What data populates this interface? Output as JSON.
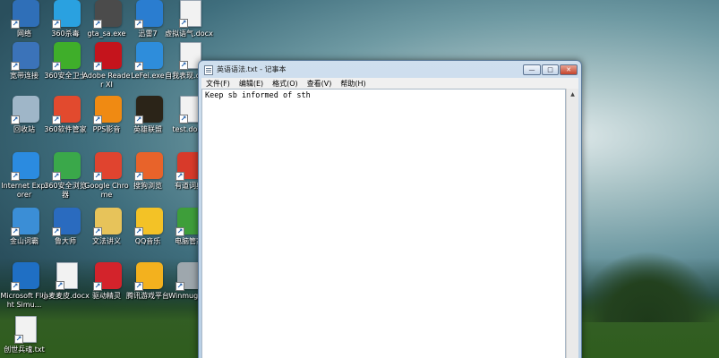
{
  "desktop_icons": [
    {
      "label": "网络",
      "icon": "network-icon",
      "color": "#2f6fb8"
    },
    {
      "label": "360杀毒",
      "icon": "360-antivirus-icon",
      "color": "#2aa1e0"
    },
    {
      "label": "gta_sa.exe",
      "icon": "gta-icon",
      "color": "#4b4b4b"
    },
    {
      "label": "迅雷7",
      "icon": "xunlei-icon",
      "color": "#2a7dd0"
    },
    {
      "label": "虚拟语气.docx",
      "icon": "docx-icon",
      "color": "#f2f2f2"
    },
    {
      "label": "宽带连接",
      "icon": "broadband-icon",
      "color": "#3b73b9"
    },
    {
      "label": "360安全卫士",
      "icon": "360-safe-icon",
      "color": "#3fae2a"
    },
    {
      "label": "Adobe Reader XI",
      "icon": "adobe-reader-icon",
      "color": "#c5141c"
    },
    {
      "label": "LeFei.exe",
      "icon": "lefei-icon",
      "color": "#2e8ddb"
    },
    {
      "label": "自我表现.docx",
      "icon": "docx-icon",
      "color": "#f2f2f2"
    },
    {
      "label": "回收站",
      "icon": "recycle-bin-icon",
      "color": "#9fb6c8"
    },
    {
      "label": "360软件管家",
      "icon": "360-software-icon",
      "color": "#e24a2e"
    },
    {
      "label": "PPS影音",
      "icon": "pps-icon",
      "color": "#f08a12"
    },
    {
      "label": "英雄联盟",
      "icon": "lol-icon",
      "color": "#2b2418"
    },
    {
      "label": "test.docx",
      "icon": "docx-icon",
      "color": "#f2f2f2"
    },
    {
      "label": "Internet Explorer",
      "icon": "ie-icon",
      "color": "#2b8be0"
    },
    {
      "label": "360安全浏览器",
      "icon": "360-browser-icon",
      "color": "#3aa84a"
    },
    {
      "label": "Google Chrome",
      "icon": "chrome-icon",
      "color": "#e0442f"
    },
    {
      "label": "搜狗浏览",
      "icon": "sogou-icon",
      "color": "#e8632a"
    },
    {
      "label": "有道词典",
      "icon": "youdao-icon",
      "color": "#d83a2a"
    },
    {
      "label": "金山词霸",
      "icon": "kingsoft-icon",
      "color": "#3b8ed6"
    },
    {
      "label": "鲁大师",
      "icon": "ludashi-icon",
      "color": "#2a6bbf"
    },
    {
      "label": "文法讲义",
      "icon": "folder-icon",
      "color": "#e7c35a"
    },
    {
      "label": "QQ音乐",
      "icon": "qq-music-icon",
      "color": "#f3c226"
    },
    {
      "label": "电脑管家",
      "icon": "pc-manager-icon",
      "color": "#3e9e3a"
    },
    {
      "label": "Microsoft Flight Simu...",
      "icon": "flight-sim-icon",
      "color": "#1f6fc4"
    },
    {
      "label": "小麦麦皮.docx",
      "icon": "docx-icon",
      "color": "#f2f2f2"
    },
    {
      "label": "驱动精灵",
      "icon": "driver-icon",
      "color": "#d3232b"
    },
    {
      "label": "腾讯游戏平台",
      "icon": "tencent-games-icon",
      "color": "#f3b11e"
    },
    {
      "label": "Winmuge...",
      "icon": "winmuge-icon",
      "color": "#9ea7ad"
    },
    {
      "label": "创世兵魂.txt",
      "icon": "txt-icon",
      "color": "#f2f2f2"
    }
  ],
  "notepad": {
    "title": "英语语法.txt - 记事本",
    "menu": [
      "文件(F)",
      "编辑(E)",
      "格式(O)",
      "查看(V)",
      "帮助(H)"
    ],
    "content": "Keep sb informed of sth",
    "controls": {
      "minimize": "—",
      "maximize": "□",
      "close": "✕"
    }
  }
}
